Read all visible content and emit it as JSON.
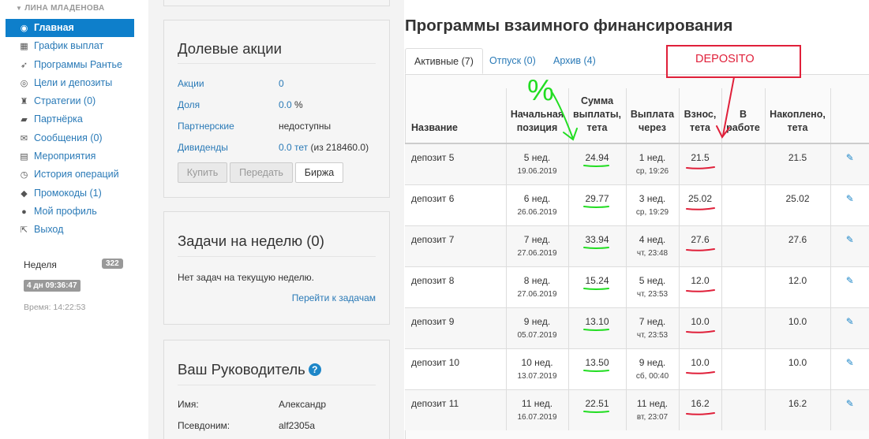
{
  "sidebar": {
    "user_name": "ЛИНА МЛАДЕНОВА",
    "nav": [
      {
        "label": "Главная",
        "icon": "dashboard-icon",
        "glyph": "◉",
        "active": true
      },
      {
        "label": "График выплат",
        "icon": "calendar-icon",
        "glyph": "▦"
      },
      {
        "label": "Программы Рантье",
        "icon": "rocket-icon",
        "glyph": "➶"
      },
      {
        "label": "Цели и депозиты",
        "icon": "target-icon",
        "glyph": "◎"
      },
      {
        "label": "Стратегии (0)",
        "icon": "chess-icon",
        "glyph": "♜"
      },
      {
        "label": "Партнёрка",
        "icon": "briefcase-icon",
        "glyph": "▰"
      },
      {
        "label": "Сообщения (0)",
        "icon": "envelope-icon",
        "glyph": "✉"
      },
      {
        "label": "Мероприятия",
        "icon": "film-icon",
        "glyph": "▤"
      },
      {
        "label": "История операций",
        "icon": "clock-icon",
        "glyph": "◷"
      },
      {
        "label": "Промокоды (1)",
        "icon": "tag-icon",
        "glyph": "◆"
      },
      {
        "label": "Мой профиль",
        "icon": "user-icon",
        "glyph": "●"
      },
      {
        "label": "Выход",
        "icon": "exit-icon",
        "glyph": "⇱"
      }
    ],
    "week_label": "Неделя",
    "week_number": "322",
    "timer": "4 дн 09:36:47",
    "time_label": "Время: 14:22:53"
  },
  "shares": {
    "title": "Долевые акции",
    "shares_label": "Акции",
    "shares_value": "0",
    "share_label": "Доля",
    "share_value": "0.0",
    "share_unit": "%",
    "partner_label": "Партнерские",
    "partner_value": "недоступны",
    "dividends_label": "Дивиденды",
    "dividends_value": "0.0 тет",
    "dividends_extra": "(из 218460.0)",
    "buy_label": "Купить",
    "transfer_label": "Передать",
    "exchange_label": "Биржа"
  },
  "tasks": {
    "title": "Задачи на неделю (0)",
    "empty_text": "Нет задач на текущую неделю.",
    "link_text": "Перейти к задачам"
  },
  "manager": {
    "title": "Ваш Руководитель",
    "name_label": "Имя:",
    "name_value": "Александр",
    "nick_label": "Псевдоним:",
    "nick_value": "alf2305a"
  },
  "main": {
    "title": "Программы взаимного финансирования",
    "tabs": [
      {
        "label": "Активные (7)",
        "active": true
      },
      {
        "label": "Отпуск (0)"
      },
      {
        "label": "Архив (4)"
      }
    ],
    "columns": [
      "Название",
      "Начальная позиция",
      "Сумма выплаты, тета",
      "Выплата через",
      "Взнос, тета",
      "В работе",
      "Накоплено, тета",
      ""
    ],
    "rows": [
      {
        "name": "депозит 5",
        "pos": "5 нед.",
        "pos_date": "19.06.2019",
        "sum": "24.94",
        "pay": "1 нед.",
        "pay_when": "ср, 19:26",
        "fee": "21.5",
        "work": "",
        "acc": "21.5"
      },
      {
        "name": "депозит 6",
        "pos": "6 нед.",
        "pos_date": "26.06.2019",
        "sum": "29.77",
        "pay": "3 нед.",
        "pay_when": "ср, 19:29",
        "fee": "25.02",
        "work": "",
        "acc": "25.02"
      },
      {
        "name": "депозит 7",
        "pos": "7 нед.",
        "pos_date": "27.06.2019",
        "sum": "33.94",
        "pay": "4 нед.",
        "pay_when": "чт, 23:48",
        "fee": "27.6",
        "work": "",
        "acc": "27.6"
      },
      {
        "name": "депозит 8",
        "pos": "8 нед.",
        "pos_date": "27.06.2019",
        "sum": "15.24",
        "pay": "5 нед.",
        "pay_when": "чт, 23:53",
        "fee": "12.0",
        "work": "",
        "acc": "12.0"
      },
      {
        "name": "депозит 9",
        "pos": "9 нед.",
        "pos_date": "05.07.2019",
        "sum": "13.10",
        "pay": "7 нед.",
        "pay_when": "чт, 23:53",
        "fee": "10.0",
        "work": "",
        "acc": "10.0"
      },
      {
        "name": "депозит 10",
        "pos": "10 нед.",
        "pos_date": "13.07.2019",
        "sum": "13.50",
        "pay": "9 нед.",
        "pay_when": "сб, 00:40",
        "fee": "10.0",
        "work": "",
        "acc": "10.0"
      },
      {
        "name": "депозит 11",
        "pos": "11 нед.",
        "pos_date": "16.07.2019",
        "sum": "22.51",
        "pay": "11 нед.",
        "pay_when": "вт, 23:07",
        "fee": "16.2",
        "work": "",
        "acc": "16.2"
      }
    ]
  },
  "annotations": {
    "percent_mark": "%",
    "deposito_label": "DEPOSITO",
    "green": "#22dd22",
    "red": "#e0203a"
  }
}
